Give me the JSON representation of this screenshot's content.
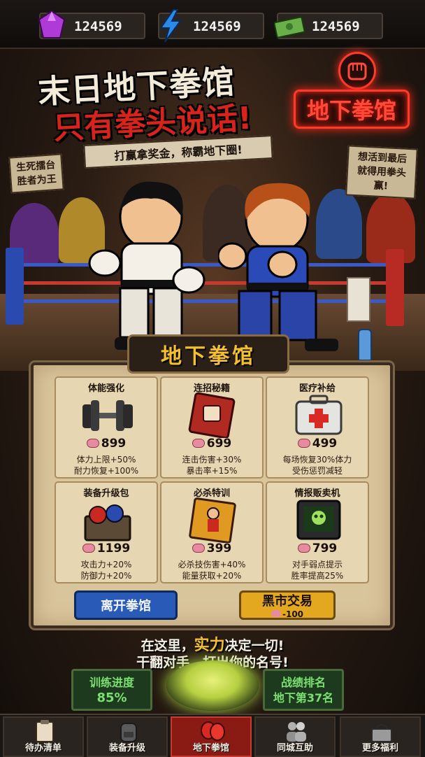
{
  "resources": [
    {
      "icon": "gem-icon",
      "value": "124569",
      "color": "#b03ad8"
    },
    {
      "icon": "lightning-icon",
      "value": "124569",
      "color": "#2a8ae8"
    },
    {
      "icon": "cash-icon",
      "value": "124569",
      "color": "#6ab04a"
    }
  ],
  "banner": {
    "title_line1": "末日地下拳馆",
    "title_line2": "只有拳头说话!",
    "subtitle": "打赢拿奖金，称霸地下圈!",
    "neon_sign": "地下拳馆",
    "sign_left": [
      "生死擂台",
      "胜者为王"
    ],
    "sign_right": [
      "想活到最后",
      "就得用拳头赢!"
    ]
  },
  "panel": {
    "title": "地下拳馆",
    "cards": [
      {
        "name": "体能强化",
        "icon": "dumbbell-icon",
        "cost": "899",
        "line1": "体力上限+50%",
        "line2": "耐力恢复+100%"
      },
      {
        "name": "连招秘籍",
        "icon": "fist-book-icon",
        "cost": "699",
        "line1": "连击伤害+30%",
        "line2": "暴击率+15%"
      },
      {
        "name": "医疗补给",
        "icon": "medkit-icon",
        "cost": "499",
        "line1": "每场恢复30%体力",
        "line2": "受伤惩罚减轻"
      },
      {
        "name": "装备升级包",
        "icon": "gear-crate-icon",
        "cost": "1199",
        "line1": "攻击力+20%",
        "line2": "防御力+20%"
      },
      {
        "name": "必杀特训",
        "icon": "fighter-book-icon",
        "cost": "399",
        "line1": "必杀技伤害+40%",
        "line2": "能量获取+20%"
      },
      {
        "name": "情报贩卖机",
        "icon": "skull-monitor-icon",
        "cost": "799",
        "line1": "对手弱点提示",
        "line2": "胜率提高25%"
      }
    ],
    "leave_button": "离开拳馆",
    "market_button": "黑市交易",
    "market_cost": "-100"
  },
  "message": {
    "line1_pre": "在这里，",
    "line1_hl": "实力",
    "line1_post": "决定一切!",
    "line2": "干翻对手，打出你的名号!"
  },
  "stats": {
    "training_label": "训练进度",
    "training_value": "85%",
    "rank_label": "战绩排名",
    "rank_value": "地下第37名"
  },
  "nav": [
    {
      "label": "待办清单",
      "icon": "clipboard-icon",
      "active": false
    },
    {
      "label": "装备升级",
      "icon": "backpack-icon",
      "active": false
    },
    {
      "label": "地下拳馆",
      "icon": "boxing-gloves-icon",
      "active": true
    },
    {
      "label": "同城互助",
      "icon": "people-icon",
      "active": false
    },
    {
      "label": "更多福利",
      "icon": "gift-basket-icon",
      "active": false
    }
  ]
}
